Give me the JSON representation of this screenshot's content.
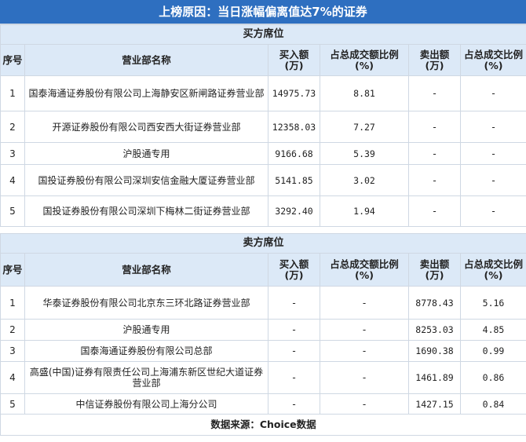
{
  "title": "上榜原因：当日涨幅偏离值达7%的证券",
  "buy_section": {
    "title": "买方席位",
    "headers": [
      "序号",
      "营业部名称",
      "买入额(万)",
      "占总成交额比例(%)",
      "卖出额(万)",
      "占总成交比例(%)"
    ],
    "rows": [
      {
        "no": "1",
        "name": "国泰海通证券股份有限公司上海静安区新闸路证券营业部",
        "buy": "14975.73",
        "buy_pct": "8.81",
        "sell": "-",
        "sell_pct": "-"
      },
      {
        "no": "2",
        "name": "开源证券股份有限公司西安西大街证券营业部",
        "buy": "12358.03",
        "buy_pct": "7.27",
        "sell": "-",
        "sell_pct": "-"
      },
      {
        "no": "3",
        "name": "沪股通专用",
        "buy": "9166.68",
        "buy_pct": "5.39",
        "sell": "-",
        "sell_pct": "-"
      },
      {
        "no": "4",
        "name": "国投证券股份有限公司深圳安信金融大厦证券营业部",
        "buy": "5141.85",
        "buy_pct": "3.02",
        "sell": "-",
        "sell_pct": "-"
      },
      {
        "no": "5",
        "name": "国投证券股份有限公司深圳下梅林二街证券营业部",
        "buy": "3292.40",
        "buy_pct": "1.94",
        "sell": "-",
        "sell_pct": "-"
      }
    ]
  },
  "sell_section": {
    "title": "卖方席位",
    "headers": [
      "序号",
      "营业部名称",
      "买入额(万)",
      "占总成交额比例(%)",
      "卖出额(万)",
      "占总成交比例(%)"
    ],
    "rows": [
      {
        "no": "1",
        "name": "华泰证券股份有限公司北京东三环北路证券营业部",
        "buy": "-",
        "buy_pct": "-",
        "sell": "8778.43",
        "sell_pct": "5.16"
      },
      {
        "no": "2",
        "name": "沪股通专用",
        "buy": "-",
        "buy_pct": "-",
        "sell": "8253.03",
        "sell_pct": "4.85"
      },
      {
        "no": "3",
        "name": "国泰海通证券股份有限公司总部",
        "buy": "-",
        "buy_pct": "-",
        "sell": "1690.38",
        "sell_pct": "0.99"
      },
      {
        "no": "4",
        "name": "高盛(中国)证券有限责任公司上海浦东新区世纪大道证券营业部",
        "buy": "-",
        "buy_pct": "-",
        "sell": "1461.89",
        "sell_pct": "0.86"
      },
      {
        "no": "5",
        "name": "中信证券股份有限公司上海分公司",
        "buy": "-",
        "buy_pct": "-",
        "sell": "1427.15",
        "sell_pct": "0.84"
      }
    ]
  },
  "footer": "数据来源：Choice数据"
}
